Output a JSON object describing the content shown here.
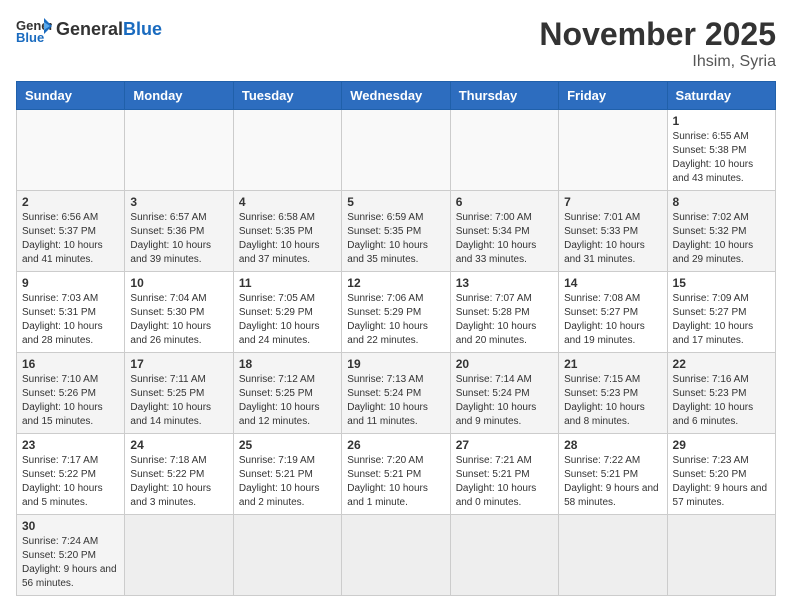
{
  "header": {
    "logo_general": "General",
    "logo_blue": "Blue",
    "month_title": "November 2025",
    "location": "Ihsim, Syria"
  },
  "days_of_week": [
    "Sunday",
    "Monday",
    "Tuesday",
    "Wednesday",
    "Thursday",
    "Friday",
    "Saturday"
  ],
  "weeks": [
    [
      {
        "day": "",
        "info": ""
      },
      {
        "day": "",
        "info": ""
      },
      {
        "day": "",
        "info": ""
      },
      {
        "day": "",
        "info": ""
      },
      {
        "day": "",
        "info": ""
      },
      {
        "day": "",
        "info": ""
      },
      {
        "day": "1",
        "info": "Sunrise: 6:55 AM\nSunset: 5:38 PM\nDaylight: 10 hours and 43 minutes."
      }
    ],
    [
      {
        "day": "2",
        "info": "Sunrise: 6:56 AM\nSunset: 5:37 PM\nDaylight: 10 hours and 41 minutes."
      },
      {
        "day": "3",
        "info": "Sunrise: 6:57 AM\nSunset: 5:36 PM\nDaylight: 10 hours and 39 minutes."
      },
      {
        "day": "4",
        "info": "Sunrise: 6:58 AM\nSunset: 5:35 PM\nDaylight: 10 hours and 37 minutes."
      },
      {
        "day": "5",
        "info": "Sunrise: 6:59 AM\nSunset: 5:35 PM\nDaylight: 10 hours and 35 minutes."
      },
      {
        "day": "6",
        "info": "Sunrise: 7:00 AM\nSunset: 5:34 PM\nDaylight: 10 hours and 33 minutes."
      },
      {
        "day": "7",
        "info": "Sunrise: 7:01 AM\nSunset: 5:33 PM\nDaylight: 10 hours and 31 minutes."
      },
      {
        "day": "8",
        "info": "Sunrise: 7:02 AM\nSunset: 5:32 PM\nDaylight: 10 hours and 29 minutes."
      }
    ],
    [
      {
        "day": "9",
        "info": "Sunrise: 7:03 AM\nSunset: 5:31 PM\nDaylight: 10 hours and 28 minutes."
      },
      {
        "day": "10",
        "info": "Sunrise: 7:04 AM\nSunset: 5:30 PM\nDaylight: 10 hours and 26 minutes."
      },
      {
        "day": "11",
        "info": "Sunrise: 7:05 AM\nSunset: 5:29 PM\nDaylight: 10 hours and 24 minutes."
      },
      {
        "day": "12",
        "info": "Sunrise: 7:06 AM\nSunset: 5:29 PM\nDaylight: 10 hours and 22 minutes."
      },
      {
        "day": "13",
        "info": "Sunrise: 7:07 AM\nSunset: 5:28 PM\nDaylight: 10 hours and 20 minutes."
      },
      {
        "day": "14",
        "info": "Sunrise: 7:08 AM\nSunset: 5:27 PM\nDaylight: 10 hours and 19 minutes."
      },
      {
        "day": "15",
        "info": "Sunrise: 7:09 AM\nSunset: 5:27 PM\nDaylight: 10 hours and 17 minutes."
      }
    ],
    [
      {
        "day": "16",
        "info": "Sunrise: 7:10 AM\nSunset: 5:26 PM\nDaylight: 10 hours and 15 minutes."
      },
      {
        "day": "17",
        "info": "Sunrise: 7:11 AM\nSunset: 5:25 PM\nDaylight: 10 hours and 14 minutes."
      },
      {
        "day": "18",
        "info": "Sunrise: 7:12 AM\nSunset: 5:25 PM\nDaylight: 10 hours and 12 minutes."
      },
      {
        "day": "19",
        "info": "Sunrise: 7:13 AM\nSunset: 5:24 PM\nDaylight: 10 hours and 11 minutes."
      },
      {
        "day": "20",
        "info": "Sunrise: 7:14 AM\nSunset: 5:24 PM\nDaylight: 10 hours and 9 minutes."
      },
      {
        "day": "21",
        "info": "Sunrise: 7:15 AM\nSunset: 5:23 PM\nDaylight: 10 hours and 8 minutes."
      },
      {
        "day": "22",
        "info": "Sunrise: 7:16 AM\nSunset: 5:23 PM\nDaylight: 10 hours and 6 minutes."
      }
    ],
    [
      {
        "day": "23",
        "info": "Sunrise: 7:17 AM\nSunset: 5:22 PM\nDaylight: 10 hours and 5 minutes."
      },
      {
        "day": "24",
        "info": "Sunrise: 7:18 AM\nSunset: 5:22 PM\nDaylight: 10 hours and 3 minutes."
      },
      {
        "day": "25",
        "info": "Sunrise: 7:19 AM\nSunset: 5:21 PM\nDaylight: 10 hours and 2 minutes."
      },
      {
        "day": "26",
        "info": "Sunrise: 7:20 AM\nSunset: 5:21 PM\nDaylight: 10 hours and 1 minute."
      },
      {
        "day": "27",
        "info": "Sunrise: 7:21 AM\nSunset: 5:21 PM\nDaylight: 10 hours and 0 minutes."
      },
      {
        "day": "28",
        "info": "Sunrise: 7:22 AM\nSunset: 5:21 PM\nDaylight: 9 hours and 58 minutes."
      },
      {
        "day": "29",
        "info": "Sunrise: 7:23 AM\nSunset: 5:20 PM\nDaylight: 9 hours and 57 minutes."
      }
    ],
    [
      {
        "day": "30",
        "info": "Sunrise: 7:24 AM\nSunset: 5:20 PM\nDaylight: 9 hours and 56 minutes."
      },
      {
        "day": "",
        "info": ""
      },
      {
        "day": "",
        "info": ""
      },
      {
        "day": "",
        "info": ""
      },
      {
        "day": "",
        "info": ""
      },
      {
        "day": "",
        "info": ""
      },
      {
        "day": "",
        "info": ""
      }
    ]
  ]
}
